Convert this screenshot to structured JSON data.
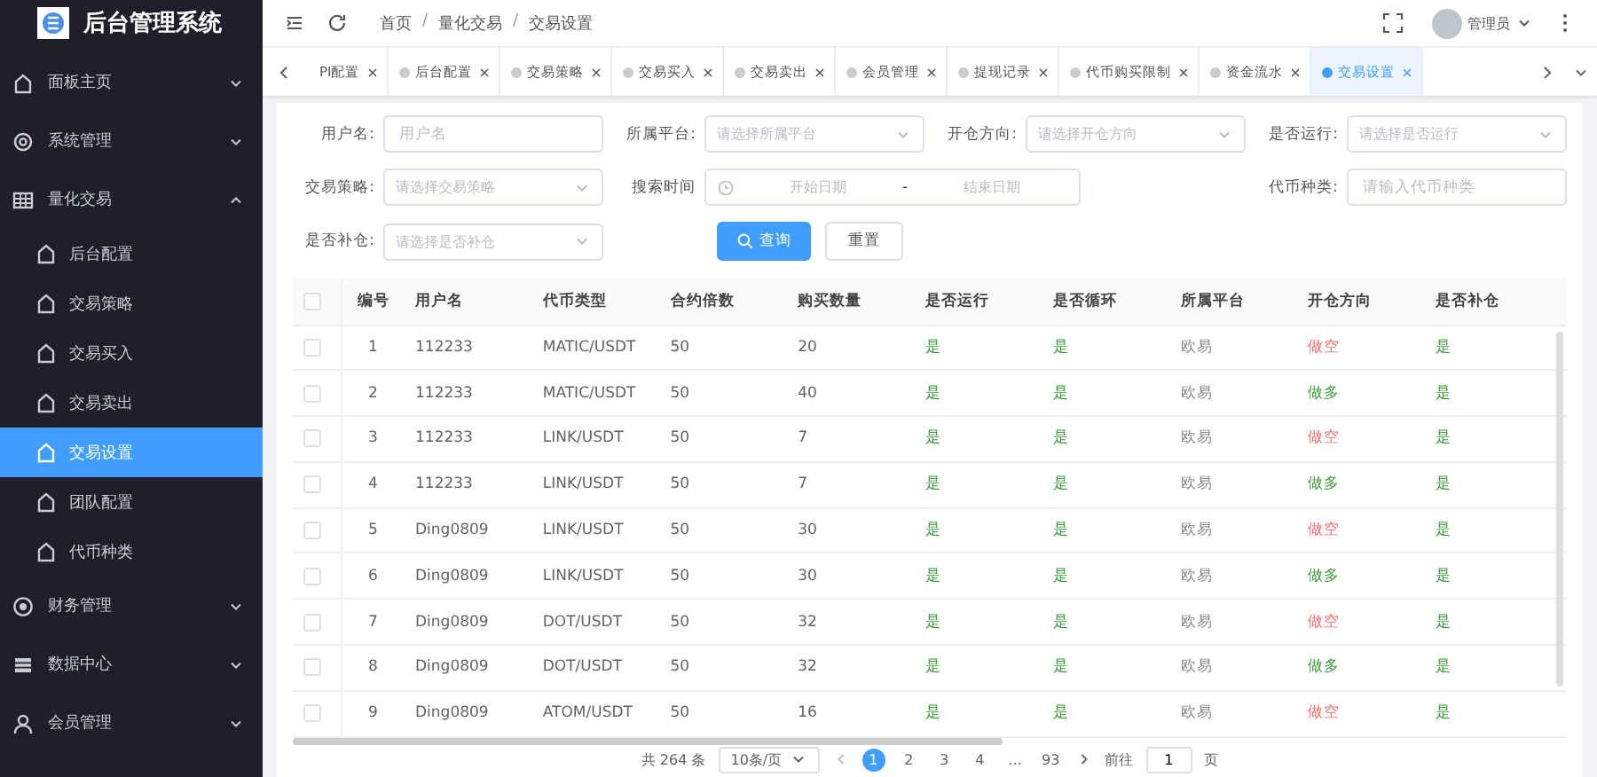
{
  "app": {
    "title": "后台管理系统"
  },
  "sidebar": {
    "items": [
      {
        "label": "面板主页",
        "expanded": false,
        "selected": false
      },
      {
        "label": "系统管理",
        "expanded": false,
        "selected": false
      },
      {
        "label": "量化交易",
        "expanded": true,
        "selected": false,
        "children": [
          {
            "label": "后台配置",
            "selected": false
          },
          {
            "label": "交易策略",
            "selected": false
          },
          {
            "label": "交易买入",
            "selected": false
          },
          {
            "label": "交易卖出",
            "selected": false
          },
          {
            "label": "交易设置",
            "selected": true
          },
          {
            "label": "团队配置",
            "selected": false
          },
          {
            "label": "代币种类",
            "selected": false
          }
        ]
      },
      {
        "label": "财务管理",
        "expanded": false,
        "selected": false
      },
      {
        "label": "数据中心",
        "expanded": false,
        "selected": false
      },
      {
        "label": "会员管理",
        "expanded": false,
        "selected": false
      }
    ]
  },
  "header": {
    "breadcrumb": [
      "首页",
      "量化交易",
      "交易设置"
    ],
    "separator": "/",
    "user": "管理员"
  },
  "tabs": [
    {
      "label": "PI配置",
      "dot": false,
      "selected": false
    },
    {
      "label": "后台配置",
      "dot": true,
      "selected": false
    },
    {
      "label": "交易策略",
      "dot": true,
      "selected": false
    },
    {
      "label": "交易买入",
      "dot": true,
      "selected": false
    },
    {
      "label": "交易卖出",
      "dot": true,
      "selected": false
    },
    {
      "label": "会员管理",
      "dot": true,
      "selected": false
    },
    {
      "label": "提现记录",
      "dot": true,
      "selected": false
    },
    {
      "label": "代币购买限制",
      "dot": true,
      "selected": false
    },
    {
      "label": "资金流水",
      "dot": true,
      "selected": false
    },
    {
      "label": "交易设置",
      "dot": true,
      "selected": true
    }
  ],
  "filters": [
    {
      "label": "用户名:",
      "kind": "input",
      "placeholder": "用户名"
    },
    {
      "label": "所属平台:",
      "kind": "select",
      "placeholder": "请选择所属平台"
    },
    {
      "label": "开仓方向:",
      "kind": "select",
      "placeholder": "请选择开仓方向"
    },
    {
      "label": "是否运行:",
      "kind": "select",
      "placeholder": "请选择是否运行"
    },
    {
      "label": "交易策略:",
      "kind": "select",
      "placeholder": "请选择交易策略"
    },
    {
      "label": "搜索时间",
      "kind": "daterange",
      "placeholder": "开始日期",
      "end_placeholder": "结束日期",
      "separator": "-"
    },
    {
      "label": "代币种类:",
      "kind": "input",
      "placeholder": "请输入代币种类"
    },
    {
      "label": "是否补仓:",
      "kind": "select",
      "placeholder": "请选择是否补仓"
    }
  ],
  "buttons": [
    {
      "label": "查询",
      "kind": "primary"
    },
    {
      "label": "重置",
      "kind": "default"
    }
  ],
  "table": {
    "select_all_checked": false,
    "columns": [
      {
        "label": "编号",
        "kind": "index"
      },
      {
        "label": "用户名",
        "kind": "text"
      },
      {
        "label": "代币类型",
        "kind": "text"
      },
      {
        "label": "合约倍数",
        "kind": "text"
      },
      {
        "label": "购买数量",
        "kind": "text"
      },
      {
        "label": "是否运行",
        "kind": "yes"
      },
      {
        "label": "是否循环",
        "kind": "yes"
      },
      {
        "label": "所属平台",
        "kind": "muted"
      },
      {
        "label": "开仓方向",
        "kind": "direction"
      },
      {
        "label": "是否补仓",
        "kind": "yes"
      }
    ],
    "rows": [
      {
        "checked": false,
        "cells": [
          "1",
          "112233",
          "MATIC/USDT",
          "50",
          "20",
          "是",
          "是",
          "欧易",
          {
            "text": "做空",
            "color": "#f56c6c"
          },
          "是"
        ]
      },
      {
        "checked": false,
        "cells": [
          "2",
          "112233",
          "MATIC/USDT",
          "50",
          "40",
          "是",
          "是",
          "欧易",
          {
            "text": "做多",
            "color": "#3a9c3a"
          },
          "是"
        ]
      },
      {
        "checked": false,
        "cells": [
          "3",
          "112233",
          "LINK/USDT",
          "50",
          "7",
          "是",
          "是",
          "欧易",
          {
            "text": "做空",
            "color": "#f56c6c"
          },
          "是"
        ]
      },
      {
        "checked": false,
        "cells": [
          "4",
          "112233",
          "LINK/USDT",
          "50",
          "7",
          "是",
          "是",
          "欧易",
          {
            "text": "做多",
            "color": "#3a9c3a"
          },
          "是"
        ]
      },
      {
        "checked": false,
        "cells": [
          "5",
          "Ding0809",
          "LINK/USDT",
          "50",
          "30",
          "是",
          "是",
          "欧易",
          {
            "text": "做空",
            "color": "#f56c6c"
          },
          "是"
        ]
      },
      {
        "checked": false,
        "cells": [
          "6",
          "Ding0809",
          "LINK/USDT",
          "50",
          "30",
          "是",
          "是",
          "欧易",
          {
            "text": "做多",
            "color": "#3a9c3a"
          },
          "是"
        ]
      },
      {
        "checked": false,
        "cells": [
          "7",
          "Ding0809",
          "DOT/USDT",
          "50",
          "32",
          "是",
          "是",
          "欧易",
          {
            "text": "做空",
            "color": "#f56c6c"
          },
          "是"
        ]
      },
      {
        "checked": false,
        "cells": [
          "8",
          "Ding0809",
          "DOT/USDT",
          "50",
          "32",
          "是",
          "是",
          "欧易",
          {
            "text": "做多",
            "color": "#3a9c3a"
          },
          "是"
        ]
      },
      {
        "checked": false,
        "cells": [
          "9",
          "Ding0809",
          "ATOM/USDT",
          "50",
          "16",
          "是",
          "是",
          "欧易",
          {
            "text": "做空",
            "color": "#f56c6c"
          },
          "是"
        ]
      }
    ]
  },
  "pagination": {
    "total": "共 264 条",
    "page_size": "10条/页",
    "pages": [
      {
        "label": "1",
        "selected": true
      },
      {
        "label": "2",
        "selected": false
      },
      {
        "label": "3",
        "selected": false
      },
      {
        "label": "4",
        "selected": false
      },
      {
        "label": "...",
        "selected": false
      },
      {
        "label": "93",
        "selected": false
      }
    ],
    "goto_label": "前往",
    "goto_value": "1",
    "goto_suffix": "页"
  }
}
